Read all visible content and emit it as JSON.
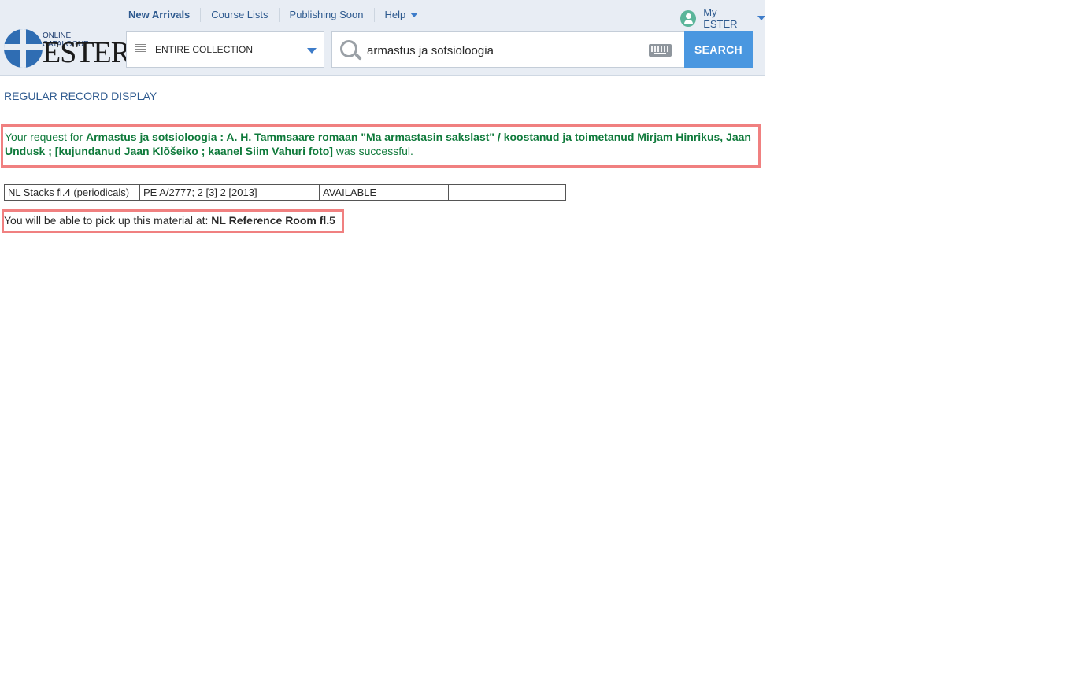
{
  "topnav": {
    "items": [
      {
        "label": "New Arrivals"
      },
      {
        "label": "Course Lists"
      },
      {
        "label": "Publishing Soon"
      },
      {
        "label": "Help"
      }
    ],
    "account_label": "My ESTER"
  },
  "logo": {
    "small_text": "ONLINE CATALOGUE",
    "big_text": "ESTER"
  },
  "collection_select": {
    "selected": "ENTIRE COLLECTION"
  },
  "search": {
    "value": "armastus ja sotsioloogia",
    "button_label": "SEARCH"
  },
  "regular_record_link": "REGULAR RECORD DISPLAY",
  "success_message": {
    "prefix": "Your request for",
    "title": "Armastus ja sotsioloogia : A. H. Tammsaare romaan \"Ma armastasin sakslast\" / koostanud ja toimetanud Mirjam Hinrikus, Jaan Undusk ; [kujundanud Jaan Klõšeiko ; kaanel Siim Vahuri foto]",
    "suffix": "was successful."
  },
  "holdings": {
    "rows": [
      {
        "location": "NL Stacks fl.4 (periodicals)",
        "call_number": "PE A/2777; 2 [3]  2 [2013]",
        "status": "AVAILABLE",
        "note": ""
      }
    ]
  },
  "pickup": {
    "prefix": "You will be able to pick up this material at:",
    "location": "NL Reference Room fl.5"
  },
  "colors": {
    "header_bg": "#e8edf4",
    "link_blue": "#2e5a8f",
    "search_button": "#4a97e0",
    "success_green": "#0f7a3b",
    "highlight_border": "#f08080",
    "avatar_green": "#5bb59a"
  }
}
